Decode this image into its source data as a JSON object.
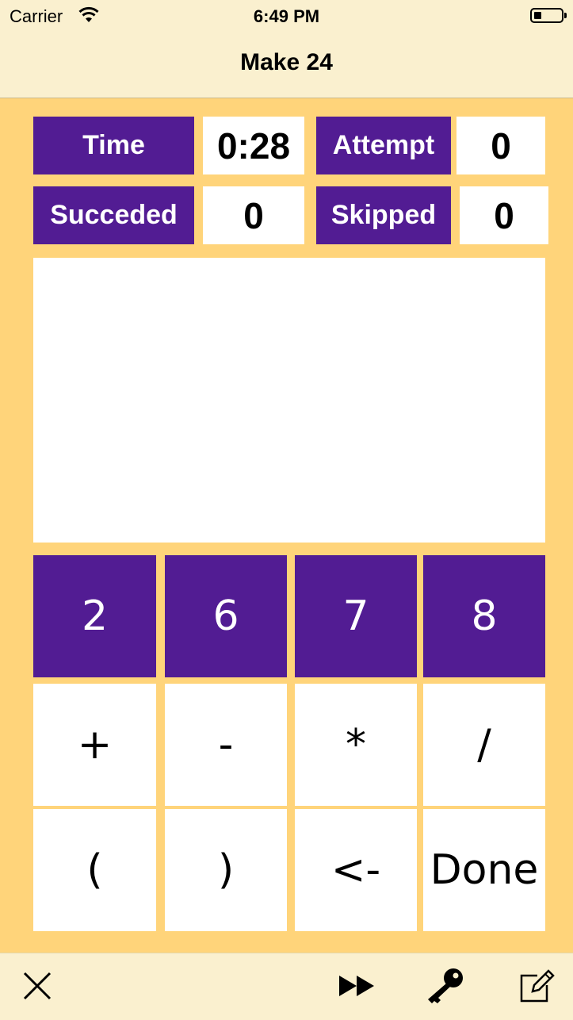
{
  "status": {
    "carrier": "Carrier",
    "time": "6:49 PM"
  },
  "nav": {
    "title": "Make 24"
  },
  "stats": {
    "time_label": "Time",
    "time_value": "0:28",
    "attempt_label": "Attempt",
    "attempt_value": "0",
    "succeeded_label": "Succeded",
    "succeeded_value": "0",
    "skipped_label": "Skipped",
    "skipped_value": "0"
  },
  "expression": "",
  "numbers": [
    "2",
    "6",
    "7",
    "8"
  ],
  "operators": [
    "+",
    "-",
    "*",
    "/"
  ],
  "controls": [
    "(",
    ")",
    "<-",
    "Done"
  ],
  "toolbar": {
    "icons": [
      "close-icon",
      "fast-forward-icon",
      "key-icon",
      "compose-icon"
    ]
  },
  "colors": {
    "accent": "#521C93",
    "background": "#FFD47A",
    "bar": "#FAF0CF"
  }
}
